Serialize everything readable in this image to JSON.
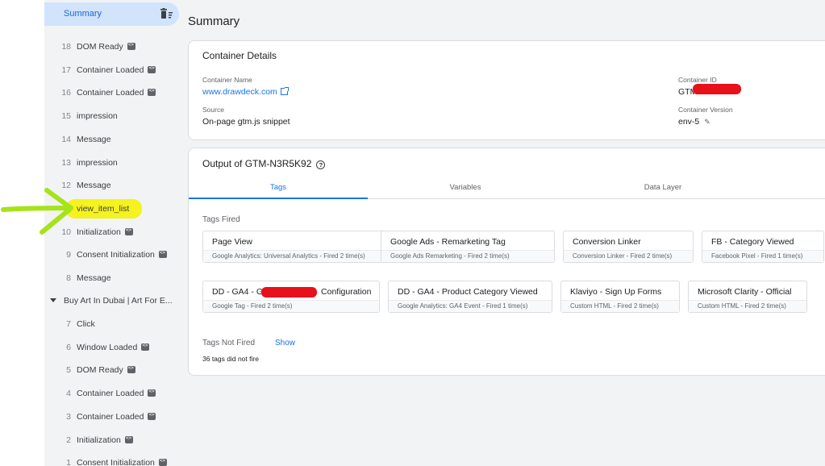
{
  "sidebar": {
    "summary_label": "Summary",
    "highlight_label": "view_item_list",
    "events": [
      {
        "num": "18",
        "name": "DOM Ready",
        "api": true
      },
      {
        "num": "17",
        "name": "Container Loaded",
        "api": true
      },
      {
        "num": "16",
        "name": "Container Loaded",
        "api": true
      },
      {
        "num": "15",
        "name": "impression",
        "api": false
      },
      {
        "num": "14",
        "name": "Message",
        "api": false
      },
      {
        "num": "13",
        "name": "impression",
        "api": false
      },
      {
        "num": "12",
        "name": "Message",
        "api": false
      },
      {
        "num": "",
        "name": "",
        "api": false
      },
      {
        "num": "10",
        "name": "Initialization",
        "api": true
      },
      {
        "num": "9",
        "name": "Consent Initialization",
        "api": true
      },
      {
        "num": "8",
        "name": "Message",
        "api": false
      }
    ],
    "group_label": "Buy Art In Dubai | Art For E...",
    "events2": [
      {
        "num": "7",
        "name": "Click",
        "api": false
      },
      {
        "num": "6",
        "name": "Window Loaded",
        "api": true
      },
      {
        "num": "5",
        "name": "DOM Ready",
        "api": true
      },
      {
        "num": "4",
        "name": "Container Loaded",
        "api": true
      },
      {
        "num": "3",
        "name": "Container Loaded",
        "api": true
      },
      {
        "num": "2",
        "name": "Initialization",
        "api": true
      },
      {
        "num": "1",
        "name": "Consent Initialization",
        "api": true
      }
    ]
  },
  "page_title": "Summary",
  "container_details": {
    "title": "Container Details",
    "name_label": "Container Name",
    "name_value": "www.drawdeck.com",
    "id_label": "Container ID",
    "id_value": "GTM",
    "source_label": "Source",
    "source_value": "On-page gtm.js snippet",
    "version_label": "Container Version",
    "version_value": "env-5"
  },
  "output": {
    "title": "Output of GTM-N3R5K92",
    "tabs": [
      "Tags",
      "Variables",
      "Data Layer"
    ],
    "tags_fired_label": "Tags Fired",
    "tags_row1": [
      {
        "name": "Page View",
        "sub": "Google Analytics: Universal Analytics - Fired 2 time(s)"
      },
      {
        "name": "Google Ads - Remarketing Tag",
        "sub": "Google Ads Remarketing - Fired 2 time(s)"
      },
      {
        "name": "Conversion Linker",
        "sub": "Conversion Linker - Fired 2 time(s)"
      },
      {
        "name": "FB - Category Viewed",
        "sub": "Facebook Pixel - Fired 1 time(s)"
      }
    ],
    "tags_row2": [
      {
        "name": "DD - GA4 - G",
        "name_end": "Configuration",
        "sub": "Google Tag - Fired 2 time(s)"
      },
      {
        "name": "DD - GA4 - Product Category Viewed",
        "sub": "Google Analytics: GA4 Event - Fired 1 time(s)"
      },
      {
        "name": "Klaviyo - Sign Up Forms",
        "sub": "Custom HTML - Fired 2 time(s)"
      },
      {
        "name": "Microsoft Clarity - Official",
        "sub": "Custom HTML - Fired 2 time(s)"
      }
    ],
    "not_fired_label": "Tags Not Fired",
    "show_label": "Show",
    "not_fired_count": "36 tags did not fire"
  },
  "colors": {
    "accent": "#1a73e8",
    "highlight": "#f5f21e",
    "arrow": "#a6e31a",
    "redaction": "#e8101a"
  }
}
